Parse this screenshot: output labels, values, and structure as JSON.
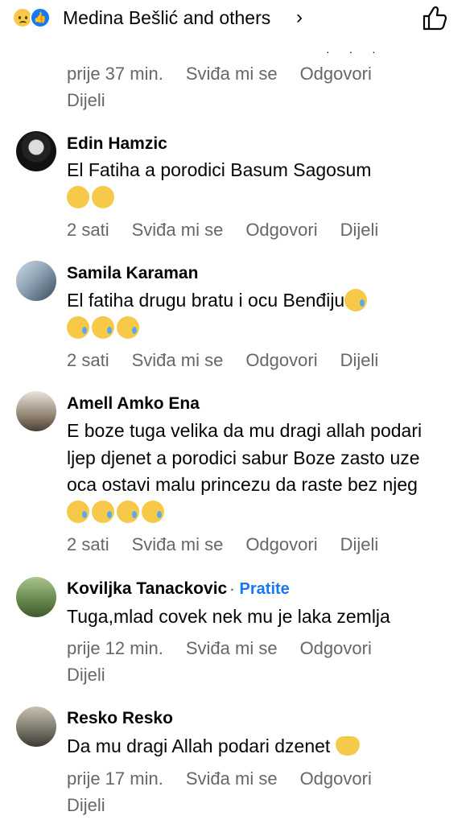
{
  "header": {
    "title": "Medina Bešlić and others",
    "reaction_icons": [
      "sad-reaction-icon",
      "like-reaction-icon"
    ],
    "like_button_icon": "thumbs-up-outline-icon"
  },
  "comments": [
    {
      "name": "",
      "text": "",
      "time": "prije 37 min.",
      "like": "Sviđa mi se",
      "reply": "Odgovori",
      "share": "Dijeli"
    },
    {
      "name": "Edin Hamzic",
      "text": "El Fatiha a porodici Basum Sagosum",
      "time": "2 sati",
      "like": "Sviđa mi se",
      "reply": "Odgovori",
      "share": "Dijeli"
    },
    {
      "name": "Samila Karaman",
      "text": "El fatiha drugu bratu i ocu Benđiju",
      "time": "2 sati",
      "like": "Sviđa mi se",
      "reply": "Odgovori",
      "share": "Dijeli"
    },
    {
      "name": "Amell Amko Ena",
      "text": "E boze tuga velika da mu dragi allah podari ljep djenet a porodici sabur Boze zasto uze oca ostavi malu princezu da raste bez njeg",
      "time": "2 sati",
      "like": "Sviđa mi se",
      "reply": "Odgovori",
      "share": "Dijeli"
    },
    {
      "name": "Koviljka Tanackovic",
      "follow": "Pratite",
      "text": "Tuga,mlad covek nek mu je laka zemlja",
      "time": "prije 12 min.",
      "like": "Sviđa mi se",
      "reply": "Odgovori",
      "share": "Dijeli"
    },
    {
      "name": "Resko Resko",
      "text": "Da mu dragi Allah podari dzenet",
      "time": "prije 17 min.",
      "like": "Sviđa mi se",
      "reply": "Odgovori",
      "share": "Dijeli"
    }
  ]
}
